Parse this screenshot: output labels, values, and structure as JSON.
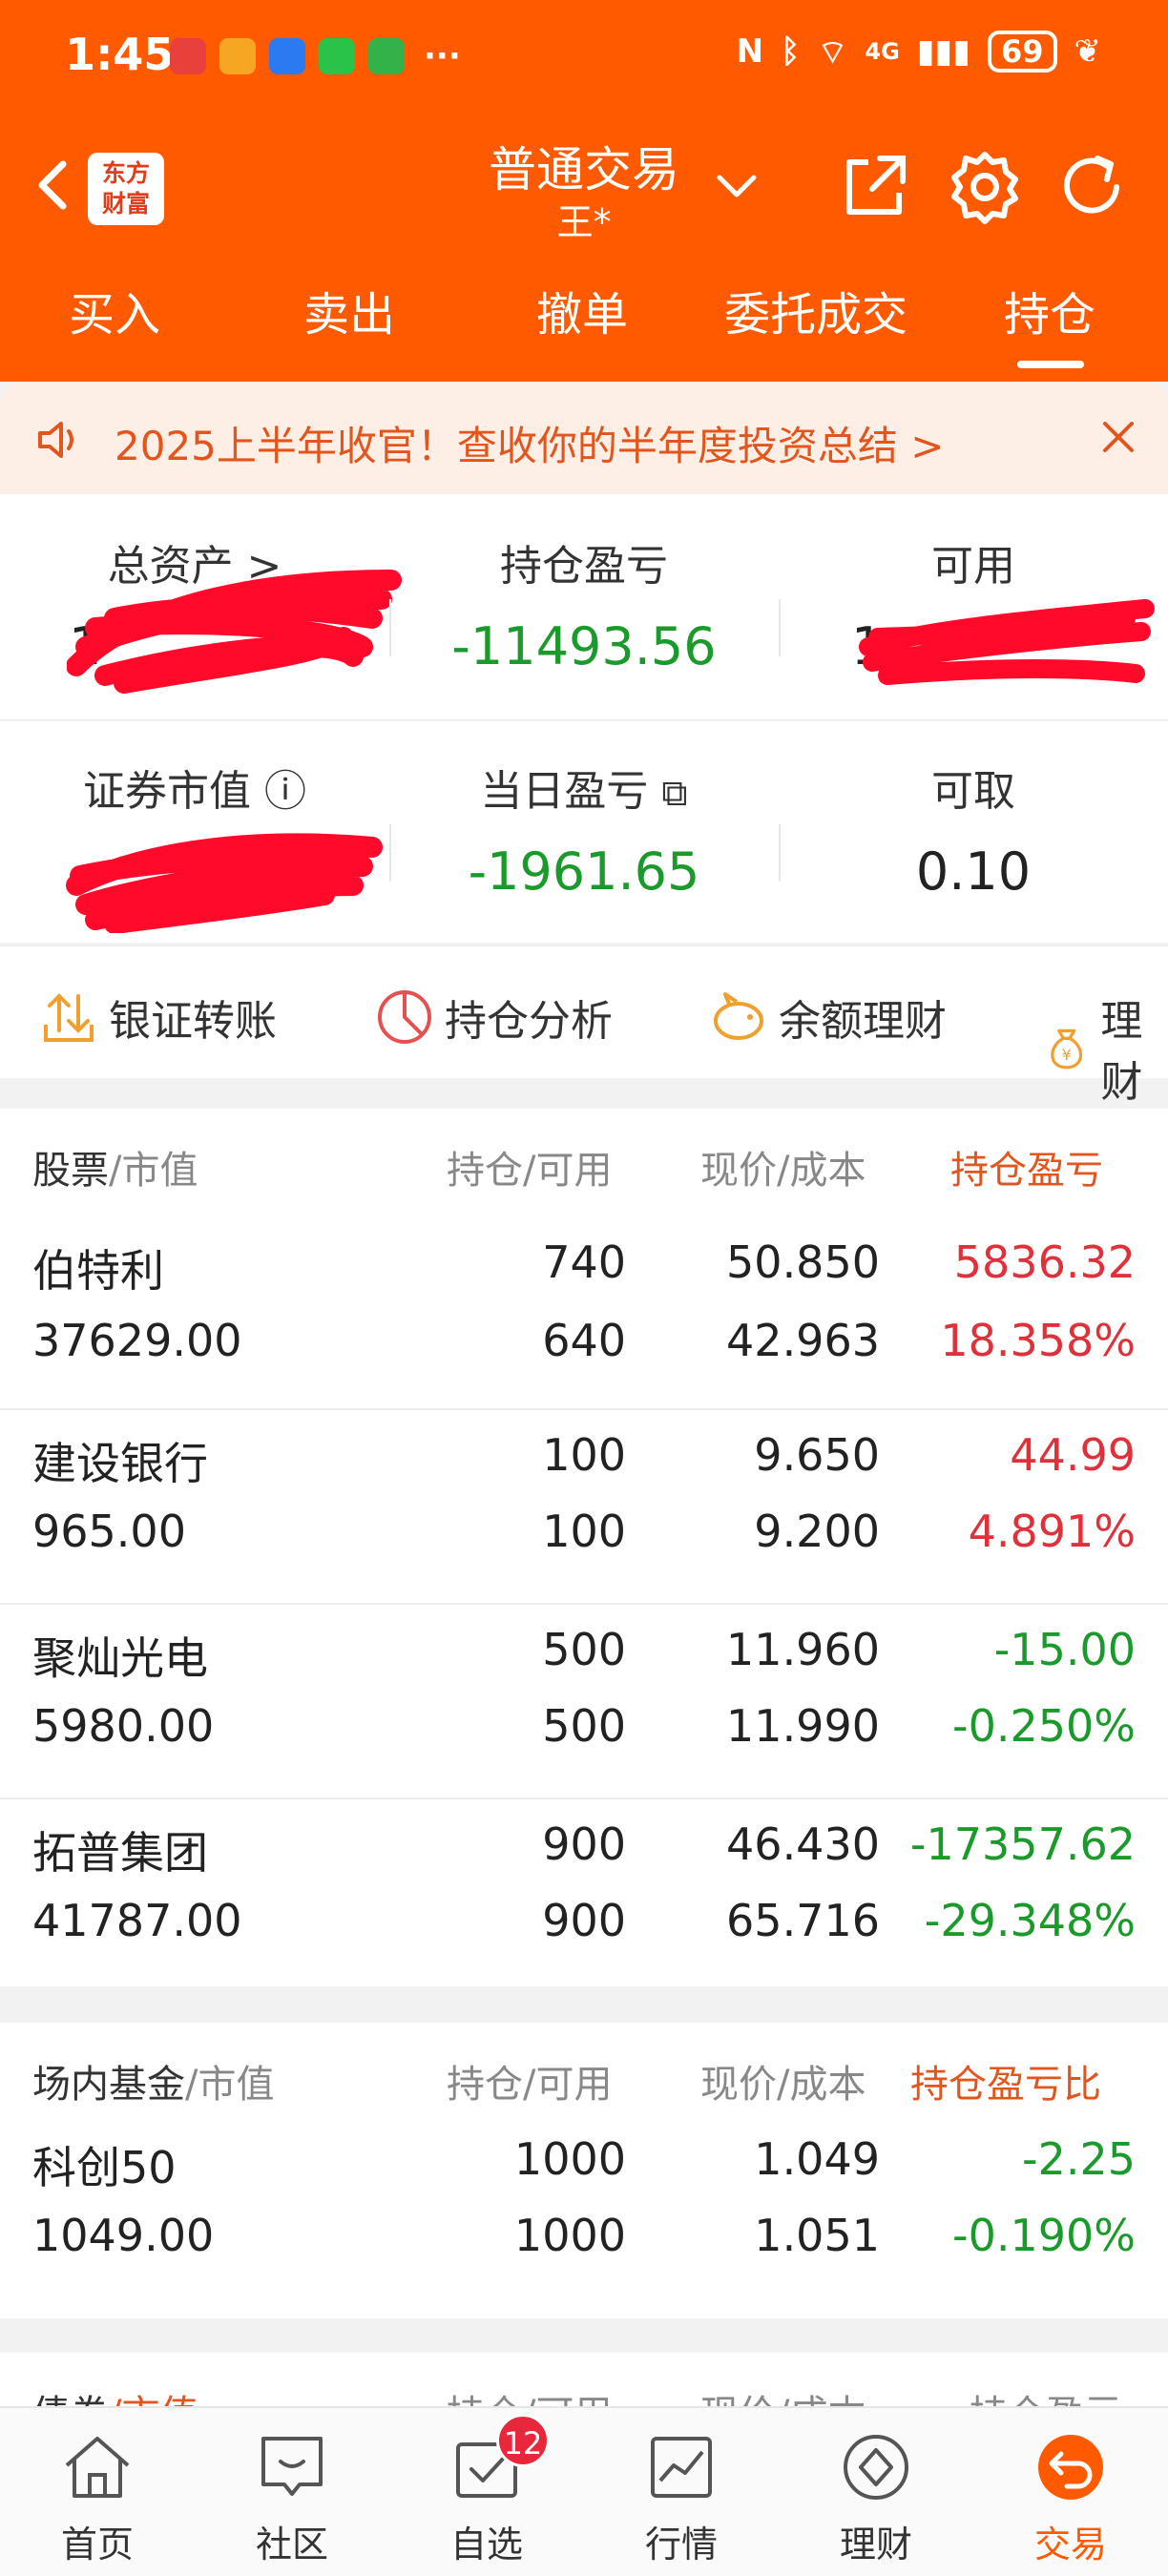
{
  "status": {
    "time": "1:45",
    "dots": "···",
    "network": "4G",
    "battery": "69"
  },
  "header": {
    "logo": "东方\n财富",
    "title": "普通交易",
    "user": "王*"
  },
  "tabs": [
    {
      "label": "买入"
    },
    {
      "label": "卖出"
    },
    {
      "label": "撤单"
    },
    {
      "label": "委托成交"
    },
    {
      "label": "持仓"
    }
  ],
  "banner": {
    "text": "2025上半年收官！查收你的半年度投资总结 >"
  },
  "summary": {
    "total_assets_label": "总资产 >",
    "total_assets_value": "1",
    "position_pl_label": "持仓盈亏",
    "position_pl_value": "-11493.56",
    "available_label": "可用",
    "available_value": "1",
    "market_value_label": "证券市值 ⓘ",
    "market_value_value": "",
    "daily_pl_label": "当日盈亏",
    "daily_pl_value": "-1961.65",
    "withdrawable_label": "可取",
    "withdrawable_value": "0.10"
  },
  "quick": [
    {
      "label": "银证转账"
    },
    {
      "label": "持仓分析"
    },
    {
      "label": "余额理财"
    },
    {
      "label": "理财"
    }
  ],
  "stocks": {
    "h1a": "股票",
    "h1b": "/市值",
    "h2": "持仓/可用",
    "h3": "现价/成本",
    "h4": "持仓盈亏",
    "rows": [
      {
        "name": "伯特利",
        "mv": "37629.00",
        "hold": "740",
        "avail": "640",
        "price": "50.850",
        "cost": "42.963",
        "pl": "5836.32",
        "plp": "18.358%"
      },
      {
        "name": "建设银行",
        "mv": "965.00",
        "hold": "100",
        "avail": "100",
        "price": "9.650",
        "cost": "9.200",
        "pl": "44.99",
        "plp": "4.891%"
      },
      {
        "name": "聚灿光电",
        "mv": "5980.00",
        "hold": "500",
        "avail": "500",
        "price": "11.960",
        "cost": "11.990",
        "pl": "-15.00",
        "plp": "-0.250%"
      },
      {
        "name": "拓普集团",
        "mv": "41787.00",
        "hold": "900",
        "avail": "900",
        "price": "46.430",
        "cost": "65.716",
        "pl": "-17357.62",
        "plp": "-29.348%"
      }
    ]
  },
  "funds": {
    "h1a": "场内基金",
    "h1b": "/市值",
    "h2": "持仓/可用",
    "h3": "现价/成本",
    "h4": "持仓盈亏比",
    "rows": [
      {
        "name": "科创50",
        "mv": "1049.00",
        "hold": "1000",
        "avail": "1000",
        "price": "1.049",
        "cost": "1.051",
        "pl": "-2.25",
        "plp": "-0.190%"
      }
    ]
  },
  "bonds": {
    "h1a": "债券",
    "h1b": "/市值",
    "h2": "持仓/可用",
    "h3": "现价/成本",
    "h4": "持仓盈亏"
  },
  "tabbar": [
    {
      "label": "首页"
    },
    {
      "label": "社区"
    },
    {
      "label": "自选",
      "badge": "12"
    },
    {
      "label": "行情"
    },
    {
      "label": "理财"
    },
    {
      "label": "交易"
    }
  ],
  "colors": {
    "brand": "#ff5a00",
    "gain": "#e0303a",
    "loss": "#1a9a2a"
  }
}
